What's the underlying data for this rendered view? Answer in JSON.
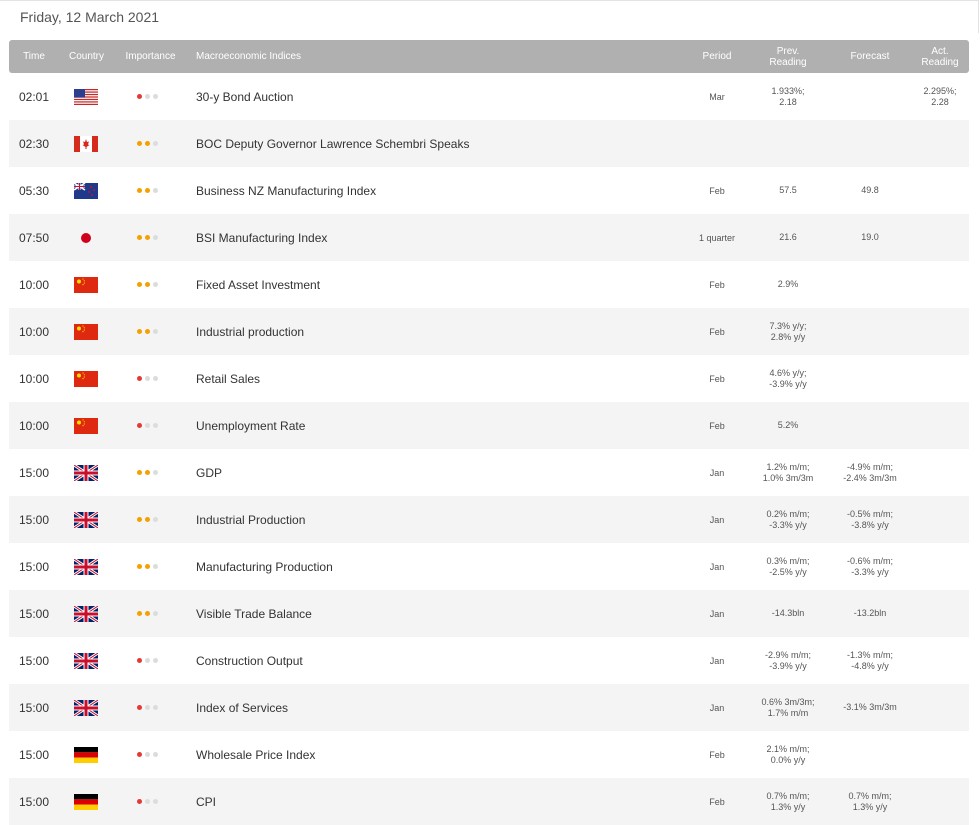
{
  "date": "Friday, 12 March 2021",
  "headers": {
    "time": "Time",
    "country": "Country",
    "importance": "Importance",
    "indices": "Macroeconomic Indices",
    "period": "Period",
    "prev": "Prev.\nReading",
    "forecast": "Forecast",
    "actual": "Act.\nReading"
  },
  "rows": [
    {
      "time": "02:01",
      "flag": "us",
      "importance": 1,
      "name": "30-y Bond Auction",
      "period": "Mar",
      "prev": "1.933%;\n2.18",
      "forecast": "",
      "actual": "2.295%;\n2.28"
    },
    {
      "time": "02:30",
      "flag": "ca",
      "importance": 2,
      "name": "BOC Deputy Governor Lawrence Schembri Speaks",
      "period": "",
      "prev": "",
      "forecast": "",
      "actual": ""
    },
    {
      "time": "05:30",
      "flag": "nz",
      "importance": 2,
      "name": "Business NZ Manufacturing Index",
      "period": "Feb",
      "prev": "57.5",
      "forecast": "49.8",
      "actual": ""
    },
    {
      "time": "07:50",
      "flag": "jp",
      "importance": 2,
      "name": "BSI Manufacturing Index",
      "period": "1 quarter",
      "prev": "21.6",
      "forecast": "19.0",
      "actual": ""
    },
    {
      "time": "10:00",
      "flag": "cn",
      "importance": 2,
      "name": "Fixed Asset Investment",
      "period": "Feb",
      "prev": "2.9%",
      "forecast": "",
      "actual": ""
    },
    {
      "time": "10:00",
      "flag": "cn",
      "importance": 2,
      "name": "Industrial production",
      "period": "Feb",
      "prev": "7.3% y/y;\n2.8% y/y",
      "forecast": "",
      "actual": ""
    },
    {
      "time": "10:00",
      "flag": "cn",
      "importance": 1,
      "name": "Retail Sales",
      "period": "Feb",
      "prev": "4.6% y/y;\n-3.9% y/y",
      "forecast": "",
      "actual": ""
    },
    {
      "time": "10:00",
      "flag": "cn",
      "importance": 1,
      "name": "Unemployment Rate",
      "period": "Feb",
      "prev": "5.2%",
      "forecast": "",
      "actual": ""
    },
    {
      "time": "15:00",
      "flag": "uk",
      "importance": 2,
      "name": "GDP",
      "period": "Jan",
      "prev": "1.2% m/m;\n1.0% 3m/3m",
      "forecast": "-4.9% m/m;\n-2.4% 3m/3m",
      "actual": ""
    },
    {
      "time": "15:00",
      "flag": "uk",
      "importance": 2,
      "name": "Industrial Production",
      "period": "Jan",
      "prev": "0.2% m/m;\n-3.3% y/y",
      "forecast": "-0.5% m/m;\n-3.8% y/y",
      "actual": ""
    },
    {
      "time": "15:00",
      "flag": "uk",
      "importance": 2,
      "name": "Manufacturing Production",
      "period": "Jan",
      "prev": "0.3% m/m;\n-2.5% y/y",
      "forecast": "-0.6% m/m;\n-3.3% y/y",
      "actual": ""
    },
    {
      "time": "15:00",
      "flag": "uk",
      "importance": 2,
      "name": "Visible Trade Balance",
      "period": "Jan",
      "prev": "-14.3bln",
      "forecast": "-13.2bln",
      "actual": ""
    },
    {
      "time": "15:00",
      "flag": "uk",
      "importance": 1,
      "name": "Construction Output",
      "period": "Jan",
      "prev": "-2.9% m/m;\n-3.9% y/y",
      "forecast": "-1.3% m/m;\n-4.8% y/y",
      "actual": ""
    },
    {
      "time": "15:00",
      "flag": "uk",
      "importance": 1,
      "name": "Index of Services",
      "period": "Jan",
      "prev": "0.6% 3m/3m;\n1.7% m/m",
      "forecast": "-3.1% 3m/3m",
      "actual": ""
    },
    {
      "time": "15:00",
      "flag": "de",
      "importance": 1,
      "name": "Wholesale Price Index",
      "period": "Feb",
      "prev": "2.1% m/m;\n0.0% y/y",
      "forecast": "",
      "actual": ""
    },
    {
      "time": "15:00",
      "flag": "de",
      "importance": 1,
      "name": "CPI",
      "period": "Feb",
      "prev": "0.7% m/m;\n1.3% y/y",
      "forecast": "0.7% m/m;\n1.3% y/y",
      "actual": ""
    }
  ],
  "colors": {
    "high_dot": "#e53935",
    "medium_dot": "#f5a000",
    "inactive_dot": "#dcdcdc",
    "header_bg": "#b0b0b0"
  }
}
